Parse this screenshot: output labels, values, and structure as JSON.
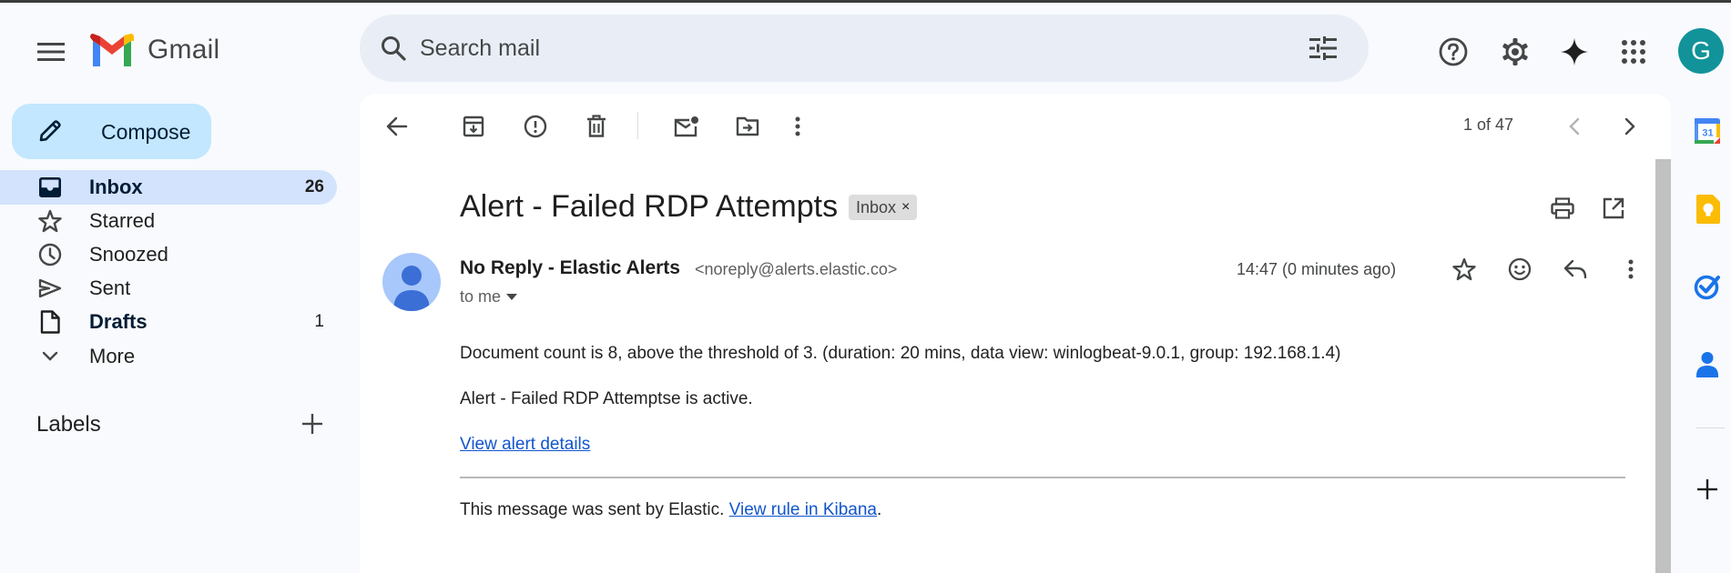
{
  "app": {
    "name": "Gmail",
    "user_initial": "G"
  },
  "search": {
    "placeholder": "Search mail",
    "value": ""
  },
  "sidebar": {
    "compose_label": "Compose",
    "items": [
      {
        "label": "Inbox",
        "count": "26",
        "active": true,
        "icon": "inbox-icon"
      },
      {
        "label": "Starred",
        "count": "",
        "icon": "star-icon"
      },
      {
        "label": "Snoozed",
        "count": "",
        "icon": "clock-icon"
      },
      {
        "label": "Sent",
        "count": "",
        "icon": "send-icon"
      },
      {
        "label": "Drafts",
        "count": "1",
        "icon": "draft-icon"
      },
      {
        "label": "More",
        "count": "",
        "icon": "chevron-down-icon"
      }
    ],
    "labels_title": "Labels"
  },
  "toolbar": {
    "pager": "1 of 47"
  },
  "email": {
    "subject": "Alert - Failed RDP Attempts",
    "label_chip": "Inbox",
    "chip_close": "×",
    "sender_name": "No Reply - Elastic Alerts",
    "sender_email": "<noreply@alerts.elastic.co>",
    "recipient": "to me",
    "timestamp": "14:47 (0 minutes ago)",
    "body_line1": "Document count is 8, above the threshold of 3. (duration: 20 mins, data view: winlogbeat-9.0.1, group: 192.168.1.4)",
    "body_line2": "Alert - Failed RDP Attemptse is active.",
    "link_view_alert": "View alert details",
    "footer_prefix": "This message was sent by Elastic.",
    "footer_link": "View rule in Kibana",
    "footer_suffix": "."
  },
  "rail": {
    "calendar_day": "31"
  },
  "colors": {
    "accent": "#0b57d0",
    "compose_bg": "#c2e7ff",
    "active_nav": "#d3e3fd",
    "avatar": "#12939a",
    "link": "#1155cc"
  }
}
